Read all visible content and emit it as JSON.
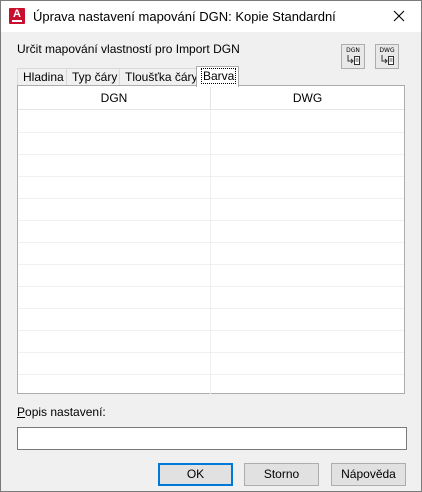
{
  "window": {
    "title": "Úprava nastavení mapování DGN: Kopie Standardní",
    "app_icon_letter": "A"
  },
  "section_label": "Určit mapování vlastností pro Import DGN",
  "toolbar": {
    "dgn_button_caption": "DGN",
    "dwg_button_caption": "DWG"
  },
  "tabs": [
    {
      "label": "Hladina",
      "active": false
    },
    {
      "label": "Typ čáry",
      "active": false
    },
    {
      "label": "Tloušťka čáry",
      "active": false
    },
    {
      "label": "Barva",
      "active": true
    }
  ],
  "table": {
    "columns": [
      "DGN",
      "DWG"
    ],
    "rows": [
      [
        "",
        ""
      ],
      [
        "",
        ""
      ],
      [
        "",
        ""
      ],
      [
        "",
        ""
      ],
      [
        "",
        ""
      ],
      [
        "",
        ""
      ],
      [
        "",
        ""
      ],
      [
        "",
        ""
      ],
      [
        "",
        ""
      ],
      [
        "",
        ""
      ],
      [
        "",
        ""
      ],
      [
        "",
        ""
      ],
      [
        "",
        ""
      ]
    ]
  },
  "description": {
    "label_accel": "P",
    "label_rest": "opis nastavení:",
    "value": ""
  },
  "buttons": {
    "ok": "OK",
    "cancel": "Storno",
    "help": "Nápověda"
  },
  "colors": {
    "app_icon": "#c8102e",
    "default_button_border": "#0078d7"
  }
}
